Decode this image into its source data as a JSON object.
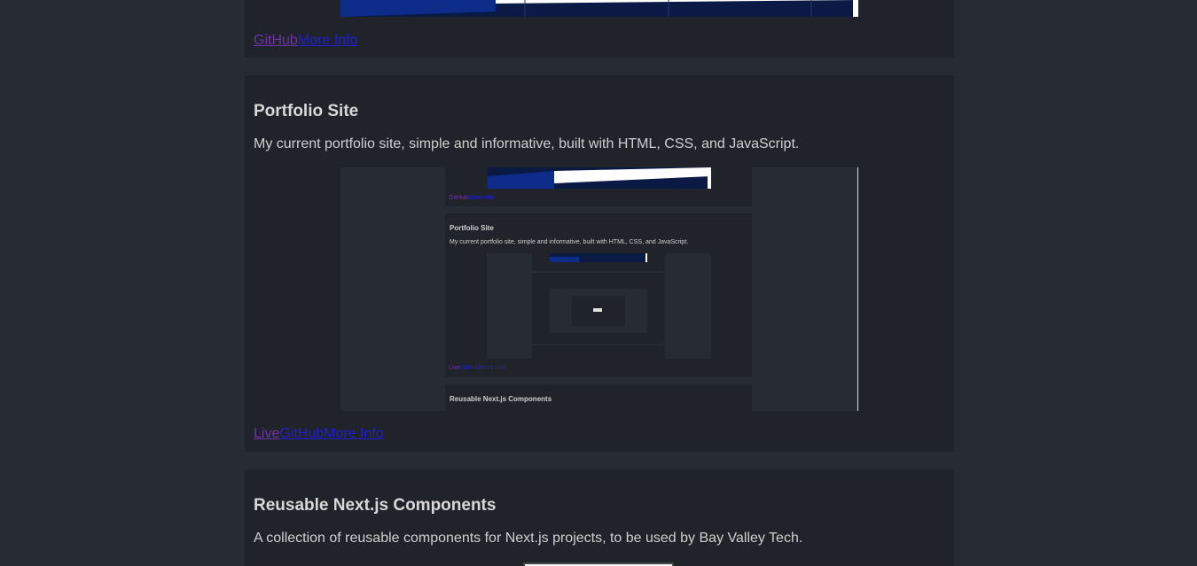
{
  "cards": {
    "top": {
      "links": {
        "github": "GitHub",
        "more_info": "More Info"
      }
    },
    "portfolio": {
      "title": "Portfolio Site",
      "description": "My current portfolio site, simple and informative, built with HTML, CSS, and JavaScript.",
      "links": {
        "live": "Live",
        "github": "GitHub",
        "more_info": "More Info"
      },
      "screenshot": {
        "card1_title": "Portfolio Site",
        "card1_desc": "My current portfolio site, simple and informative, built with HTML, CSS, and JavaScript.",
        "card2_title": "Reusable Next.js Components"
      }
    },
    "reusable": {
      "title": "Reusable Next.js Components",
      "description": "A collection of reusable components for Next.js projects, to be used by Bay Valley Tech."
    }
  },
  "colors": {
    "page_bg": "#272b33",
    "card_bg": "#202329",
    "banner_blue": "#0d2c8a",
    "link_visited": "#6e34a8",
    "link_blue": "#1f1fd6"
  }
}
